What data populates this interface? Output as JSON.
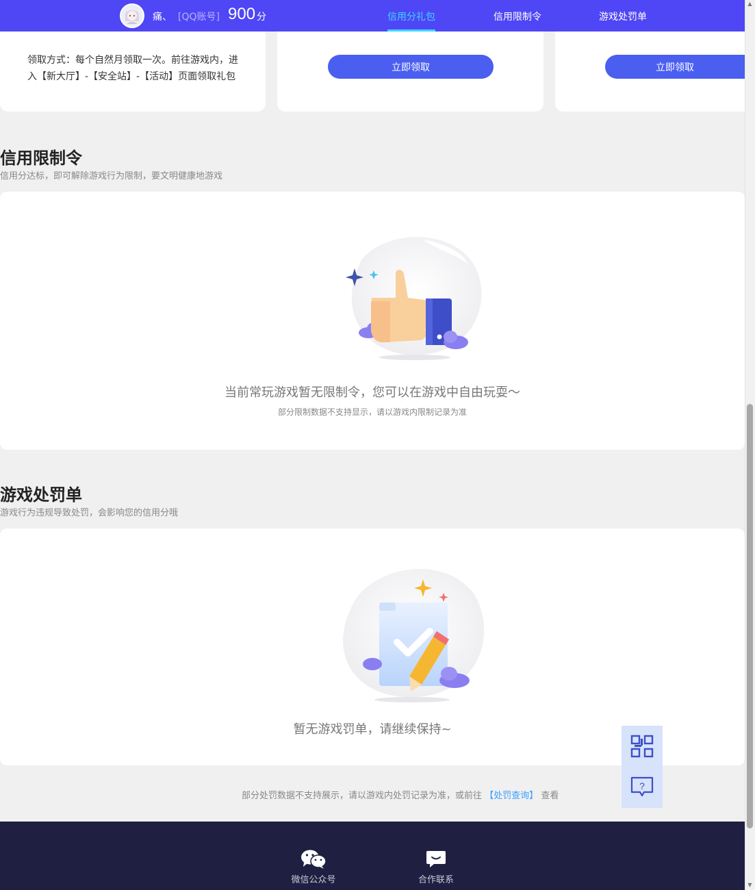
{
  "header": {
    "user_name": "痛、",
    "account_type": "[QQ账号]",
    "score": "900",
    "score_unit": "分",
    "tabs": [
      {
        "label": "信用分礼包",
        "active": true
      },
      {
        "label": "信用限制令",
        "active": false
      },
      {
        "label": "游戏处罚单",
        "active": false
      }
    ]
  },
  "gift_cards": {
    "description": "领取方式：每个自然月领取一次。前往游戏内，进入【新大厅】-【安全站】-【活动】页面领取礼包",
    "claim_label": "立即领取"
  },
  "restriction": {
    "title": "信用限制令",
    "subtitle": "信用分达标，即可解除游戏行为限制，要文明健康地游戏",
    "empty_message": "当前常玩游戏暂无限制令，您可以在游戏中自由玩耍～",
    "empty_note": "部分限制数据不支持显示，请以游戏内限制记录为准"
  },
  "penalty": {
    "title": "游戏处罚单",
    "subtitle": "游戏行为违规导致处罚，会影响您的信用分哦",
    "empty_message": "暂无游戏罚单，请继续保持~",
    "footnote_prefix": "部分处罚数据不支持展示，请以游戏内处罚记录为准，或前往",
    "footnote_link": "【处罚查询】",
    "footnote_suffix": "查看"
  },
  "footer": {
    "wechat_label": "微信公众号",
    "contact_label": "合作联系"
  },
  "colors": {
    "nav_bg": "#4f46f5",
    "active_tab": "#3bd5ff",
    "button": "#4a5ef0",
    "footer_bg": "#1e1f41",
    "link": "#3aa0ff"
  },
  "icons": [
    "qr-code-icon",
    "help-chat-icon",
    "wechat-icon",
    "message-icon",
    "thumbs-up-illustration",
    "checklist-illustration"
  ]
}
